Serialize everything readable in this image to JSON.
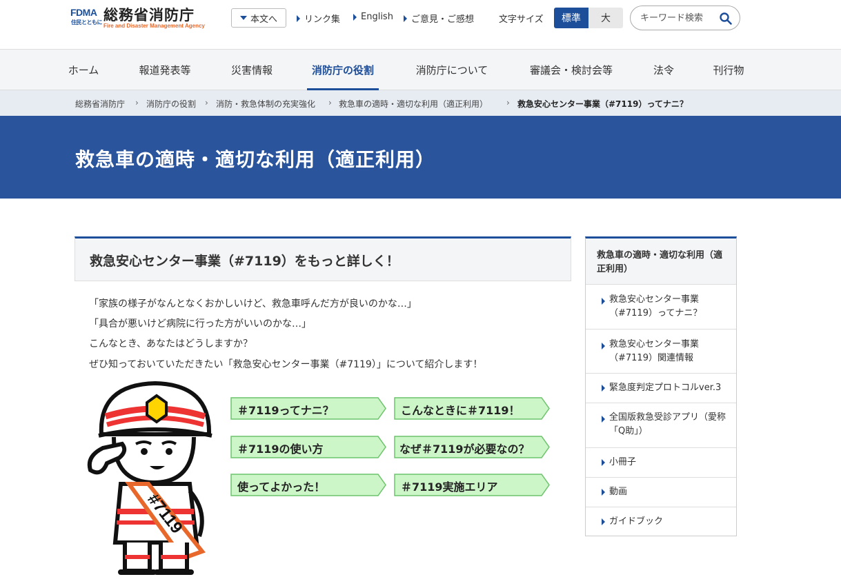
{
  "header": {
    "logo_fdma": "FDMA",
    "logo_fdma_sub": "住民とともに",
    "logo_name": "総務省消防庁",
    "logo_en": "Fire and Disaster Management Agency",
    "skip_label": "本文へ",
    "links": [
      "リンク集",
      "English",
      "ご意見・ご感想"
    ],
    "font_size_label": "文字サイズ",
    "font_size_standard": "標準",
    "font_size_large": "大",
    "search_placeholder": "キーワード検索"
  },
  "nav": {
    "items": [
      "ホーム",
      "報道発表等",
      "災害情報",
      "消防庁の役割",
      "消防庁について",
      "審議会・検討会等",
      "法令",
      "刊行物"
    ],
    "active_index": 3
  },
  "breadcrumb": [
    "総務省消防庁",
    "消防庁の役割",
    "消防・救急体制の充実強化",
    "救急車の適時・適切な利用（適正利用）",
    "救急安心センター事業（#7119）ってナニ？"
  ],
  "hero": {
    "title": "救急車の適時・適切な利用（適正利用）"
  },
  "main": {
    "section_title": "救急安心センター事業（#7119）をもっと詳しく！",
    "paragraphs": [
      "「家族の様子がなんとなくおかしいけど、救急車呼んだ方が良いのかな…」",
      "「具合が悪いけど病院に行った方がいいのかな…」",
      "こんなとき、あなたはどうしますか？",
      "ぜひ知っておいていただきたい「救急安心センター事業（#7119）」について紹介します！"
    ],
    "mascot_sash": "#7119",
    "buttons": [
      "＃7119ってナニ？",
      "こんなときに＃7119！",
      "＃7119の使い方",
      "なぜ＃7119が必要なの？",
      "使ってよかった！",
      "＃7119実施エリア"
    ]
  },
  "sidebar": {
    "title": "救急車の適時・適切な利用（適正利用）",
    "items": [
      "救急安心センター事業（#7119）ってナニ？",
      "救急安心センター事業（#7119）関連情報",
      "緊急度判定プロトコルver.3",
      "全国版救急受診アプリ（愛称「Q助」）",
      "小冊子",
      "動画",
      "ガイドブック"
    ]
  },
  "colors": {
    "brand_blue": "#1d4e9a",
    "hero_blue": "#2a559c",
    "button_green": "#ccf5c8",
    "button_green_border": "#6cc46a",
    "accent_orange": "#e8682c"
  }
}
